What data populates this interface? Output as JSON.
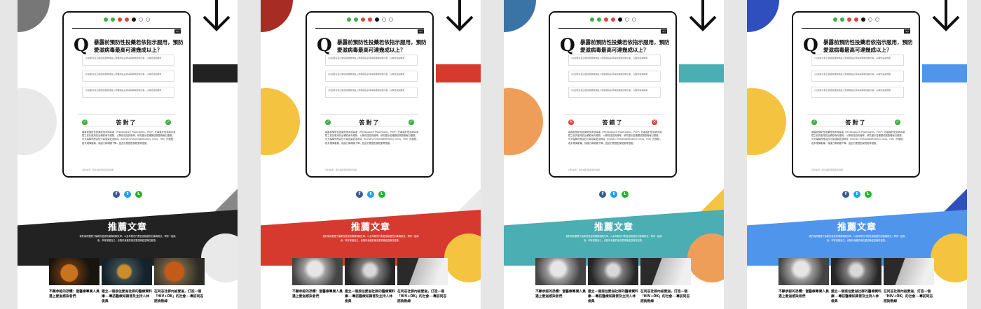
{
  "question": {
    "title": "暴露前預防性投藥若依指示服用，預防愛滋病毒最高可達幾成以上？",
    "qmark": "Q",
    "tag": "3/7",
    "options": [
      "(1)如果沒有正確使用藥物或進入發展階段必須採用藥物控制計畫，以降低感染機率",
      "(2)如果沒有正確使用藥物或進入發展階段必須採用藥物控制計畫，以降低感染機率",
      "(3)如果沒有正確使用藥物或進入發展階段必須採用藥物控制計畫，以降低感染機率"
    ],
    "explanation": "暴露前預防性投藥是指未感染者（Preexposure Prophylaxis，PrEP）在暴露於愛滋病毒風險之前先服用抗反轉錄病毒藥物，以降低感染的機率。研究顯示若確實依照醫囑每日服藥，可大幅降低經由性行為感染愛滋病毒（human immunodeficiency virus，HIV）的風險；若未規律服藥，保護力將明顯下降，因此仍應搭配保險套等措施。",
    "source": "資料來源：衛生福利部疾病管制署"
  },
  "share": [
    "f",
    "t",
    "L"
  ],
  "recommend": {
    "title": "推薦文章",
    "desc": "我們為你整理了最新的愛滋知識與相關文章，以及年輕世代對愛滋議題的討論與看法，帶你一起探索，學會保護自己，也陪伴身邊的朋友更認識愛滋與性健康。"
  },
  "articles": [
    {
      "caption": "不願承認的恐懼：當醫療專業人員遇上愛滋感染者們"
    },
    {
      "caption": "建立一個接住愛滋社群的醫療資料庫──專訪醫療知識普及主持人林俊典"
    },
    {
      "caption": "在同志社群內被愛滋，打造一個「HIV+OK」的社會──專訪同志諮詢熱線"
    }
  ],
  "panels": [
    {
      "theme": "gray",
      "primary": "#222222",
      "secondary": "#bfbfbf",
      "circle": "#e9e9e9",
      "accent": "#888888",
      "result": "答對了",
      "correct": true,
      "ricon": "#3cb043",
      "arrow": "#111111"
    },
    {
      "theme": "red",
      "primary": "#d63a2f",
      "secondary": "#a72c24",
      "circle": "#f4c441",
      "accent": "#e9e9e9",
      "result": "答對了",
      "correct": true,
      "ricon": "#3cb043",
      "arrow": "#111111"
    },
    {
      "theme": "teal",
      "primary": "#4aaeb3",
      "secondary": "#3a73a6",
      "circle": "#ef9e59",
      "accent": "#f4c441",
      "result": "答錯了",
      "correct": false,
      "ricon": "#e0453a",
      "arrow": "#111111"
    },
    {
      "theme": "blue",
      "primary": "#4f95ec",
      "secondary": "#2f4fbe",
      "circle": "#f4c441",
      "accent": "#2f4fbe",
      "result": "答對了",
      "correct": true,
      "ricon": "#3cb043",
      "arrow": "#111111"
    }
  ],
  "share_colors": [
    "#3b5998",
    "#1da1f2",
    "#21b52a"
  ]
}
